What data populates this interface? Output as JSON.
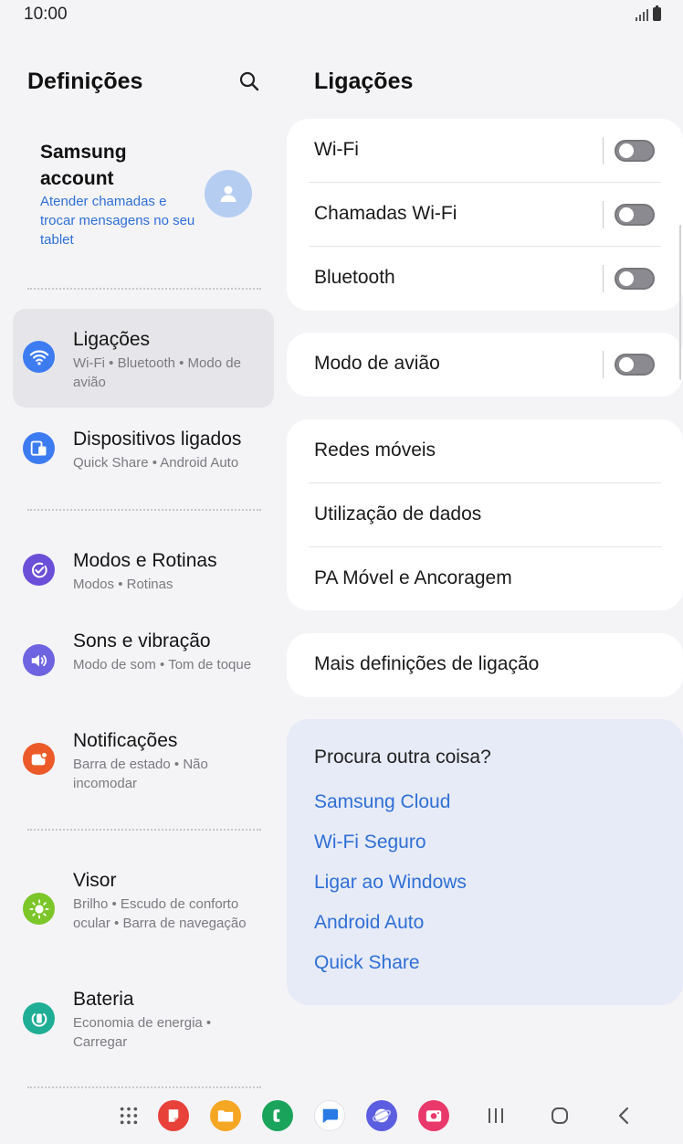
{
  "status": {
    "time": "10:00"
  },
  "left": {
    "title": "Definições",
    "account": {
      "name": "Samsung account",
      "subtitle": "Atender chamadas e trocar mensagens no seu tablet"
    },
    "items": [
      {
        "title": "Ligações",
        "subtitle": "Wi-Fi • Bluetooth • Modo de avião",
        "icon": "wifi-icon",
        "color": "#3d7bf0"
      },
      {
        "title": "Dispositivos ligados",
        "subtitle": "Quick Share • Android Auto",
        "icon": "devices-icon",
        "color": "#3d7bf0"
      },
      {
        "title": "Modos e Rotinas",
        "subtitle": "Modos • Rotinas",
        "icon": "modes-icon",
        "color": "#6b4fd8"
      },
      {
        "title": "Sons e vibração",
        "subtitle": "Modo de som • Tom de toque",
        "icon": "speaker-icon",
        "color": "#6e63e0"
      },
      {
        "title": "Notificações",
        "subtitle": "Barra de estado • Não incomodar",
        "icon": "notification-icon",
        "color": "#ec5a2a"
      },
      {
        "title": "Visor",
        "subtitle": "Brilho • Escudo de conforto ocular • Barra de navegação",
        "icon": "sun-icon",
        "color": "#7cc629"
      },
      {
        "title": "Bateria",
        "subtitle": "Economia de energia • Carregar",
        "icon": "battery-icon",
        "color": "#1fae95"
      }
    ]
  },
  "right": {
    "title": "Ligações",
    "wifi": "Wi-Fi",
    "wifi_calling": "Chamadas Wi-Fi",
    "bluetooth": "Bluetooth",
    "airplane": "Modo de avião",
    "mobile_networks": "Redes móveis",
    "data_usage": "Utilização de dados",
    "hotspot": "PA Móvel e Ancoragem",
    "more": "Mais definições de ligação",
    "toggles": {
      "wifi": false,
      "wifi_calling": false,
      "bluetooth": false,
      "airplane": false
    },
    "lookfor": {
      "title": "Procura outra coisa?",
      "links": [
        "Samsung Cloud",
        "Wi-Fi Seguro",
        "Ligar ao Windows",
        "Android Auto",
        "Quick Share"
      ]
    }
  },
  "dock": {
    "apps": [
      {
        "icon": "apps-grid-icon"
      },
      {
        "icon": "notes-app-icon",
        "color": "#e8413a"
      },
      {
        "icon": "files-app-icon",
        "color": "#f5a623"
      },
      {
        "icon": "phone-app-icon",
        "color": "#1aa35a"
      },
      {
        "icon": "messages-app-icon",
        "color": "#2a7be4"
      },
      {
        "icon": "internet-app-icon",
        "color": "#5b5ee0"
      },
      {
        "icon": "camera-app-icon",
        "color": "#e9386a"
      }
    ]
  }
}
